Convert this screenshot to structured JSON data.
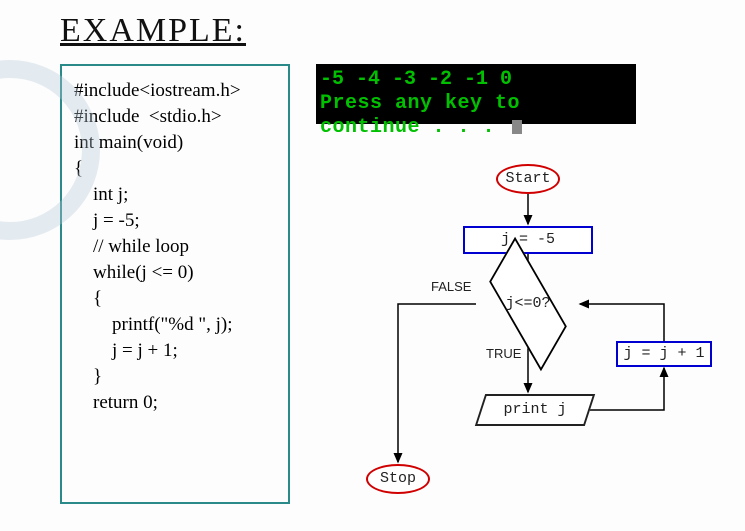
{
  "title": "EXAMPLE:",
  "code": {
    "lines": [
      "#include<iostream.h>",
      "#include  <stdio.h>",
      "int main(void)",
      "{",
      "    int j;",
      "    j = -5;",
      "    // while loop",
      "    while(j <= 0)",
      "    {",
      "        printf(\"%d \", j);",
      "        j = j + 1;",
      "    }",
      "    return 0;"
    ]
  },
  "console": {
    "line1": "-5 -4 -3 -2 -1 0",
    "line2": "Press any key to continue . . . "
  },
  "flow": {
    "start": "Start",
    "init": "j = -5",
    "cond": "j<=0?",
    "false": "FALSE",
    "true": "TRUE",
    "incr": "j = j + 1",
    "print": "print j",
    "stop": "Stop"
  },
  "chart_data": {
    "type": "flowchart",
    "nodes": [
      {
        "id": "start",
        "shape": "terminator",
        "label": "Start"
      },
      {
        "id": "init",
        "shape": "process",
        "label": "j = -5"
      },
      {
        "id": "cond",
        "shape": "decision",
        "label": "j<=0?"
      },
      {
        "id": "print",
        "shape": "io",
        "label": "print j"
      },
      {
        "id": "incr",
        "shape": "process",
        "label": "j = j + 1"
      },
      {
        "id": "stop",
        "shape": "terminator",
        "label": "Stop"
      }
    ],
    "edges": [
      {
        "from": "start",
        "to": "init"
      },
      {
        "from": "init",
        "to": "cond"
      },
      {
        "from": "cond",
        "to": "print",
        "label": "TRUE"
      },
      {
        "from": "cond",
        "to": "stop",
        "label": "FALSE"
      },
      {
        "from": "print",
        "to": "incr"
      },
      {
        "from": "incr",
        "to": "cond"
      }
    ]
  }
}
